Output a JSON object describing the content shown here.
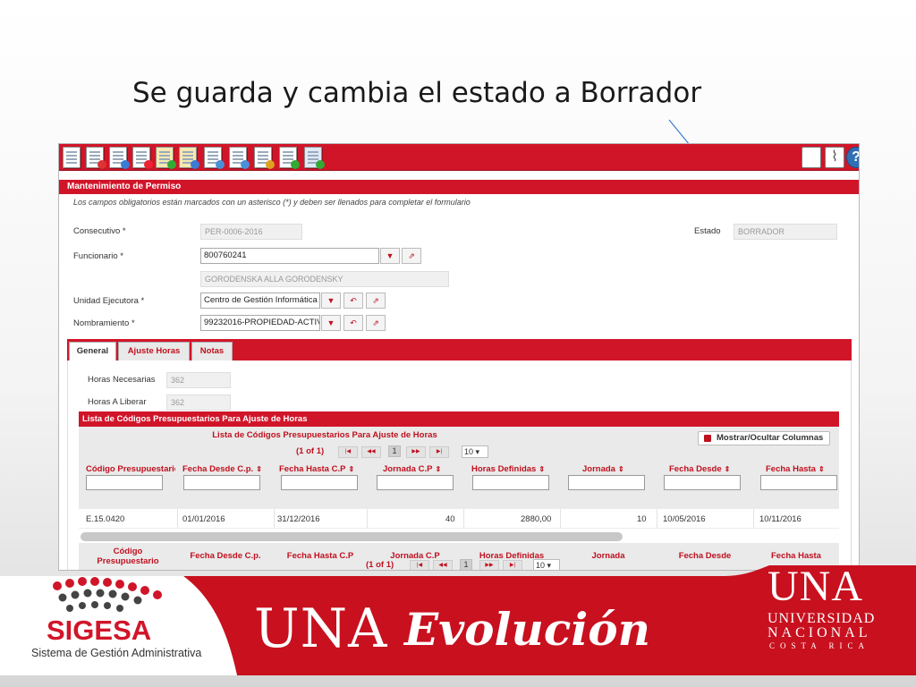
{
  "slide": {
    "title": "Se guarda y cambia el estado a Borrador"
  },
  "section_title": "Mantenimiento de Permiso",
  "notice": "Los campos obligatorios están marcados con un asterisco (*) y deben ser llenados para completar el formulario",
  "form": {
    "consecutivo": {
      "label": "Consecutivo *",
      "value": "PER-0006-2016"
    },
    "estado": {
      "label": "Estado",
      "value": "BORRADOR"
    },
    "funcionario": {
      "label": "Funcionario *",
      "value": "800760241",
      "name": "GORODENSKA  ALLA GORODENSKY"
    },
    "unidad": {
      "label": "Unidad Ejecutora *",
      "value": "Centro de Gestión Informática"
    },
    "nombramiento": {
      "label": "Nombramiento *",
      "value": "99232016-PROPIEDAD-ACTIV"
    }
  },
  "tabs": [
    {
      "label": "General"
    },
    {
      "label": "Ajuste Horas"
    },
    {
      "label": "Notas"
    }
  ],
  "horas": {
    "necesarias": {
      "label": "Horas Necesarias",
      "value": "362"
    },
    "liberar": {
      "label": "Horas A Liberar",
      "value": "362"
    }
  },
  "grid": {
    "outer_title": "Lista de Códigos Presupuestarios Para Ajuste de Horas",
    "inner_title": "Lista de Códigos Presupuestarios Para Ajuste de Horas",
    "pager": {
      "text": "(1 of 1)",
      "page": "1",
      "rows": "10 ▾"
    },
    "toggle_label": "Mostrar/Ocultar Columnas",
    "columns": [
      "Código Presupuestario",
      "Fecha Desde C.p.",
      "Fecha Hasta C.P",
      "Jornada C.P",
      "Horas Definidas",
      "Jornada",
      "Fecha Desde",
      "Fecha Hasta"
    ],
    "footer_columns": [
      "Código Presupuestario",
      "Fecha Desde C.p.",
      "Fecha Hasta C.P",
      "Jornada C.P",
      "Horas Definidas",
      "Jornada",
      "Fecha Desde",
      "Fecha Hasta"
    ],
    "row": [
      "E.15.0420",
      "01/01/2016",
      "31/12/2016",
      "40",
      "2880,00",
      "10",
      "10/05/2016",
      "10/11/2016"
    ]
  },
  "footer": {
    "sigesa_name": "SIGESA",
    "sigesa_sub": "Sistema de Gestión Administrativa",
    "una_big": "UNA",
    "evolucion": "Evolución",
    "una_logo": "UNA",
    "universidad": "UNIVERSIDAD",
    "nacional": "NACIONAL",
    "costa_rica": "COSTA RICA"
  },
  "colors": {
    "brand_red": "#d11529",
    "link_red": "#c0101e"
  },
  "icons": [
    "new-document-icon",
    "copy-document-icon",
    "save-document-icon",
    "delete-document-icon",
    "approve-clipboard-icon",
    "clipboard-icon",
    "search-icon",
    "search-list-icon",
    "calendar-icon",
    "export-icon",
    "user-add-icon",
    "layout-icon",
    "attachment-icon",
    "help-icon"
  ]
}
